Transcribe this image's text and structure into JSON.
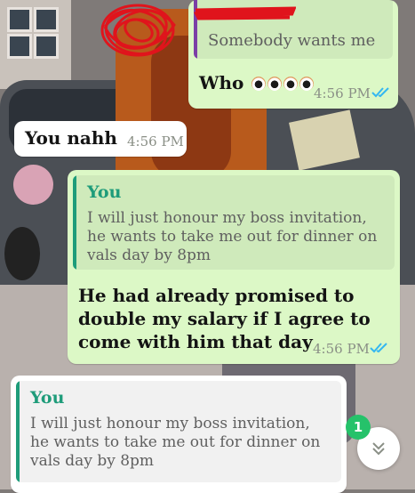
{
  "chat": {
    "m1": {
      "quote_text": "Somebody wants me",
      "text": "Who",
      "emojis": [
        "eyes-emoji",
        "eyes-emoji",
        "eyes-emoji",
        "eyes-emoji"
      ],
      "time": "4:56 PM"
    },
    "m2": {
      "text": "You nahh",
      "time": "4:56 PM"
    },
    "m3": {
      "quote_author": "You",
      "quote_text": "I will just honour my boss invitation, he wants to take me out for dinner on vals day by 8pm",
      "text": "He had already promised to double my salary if I agree to come with him that day",
      "time": "4:56 PM"
    },
    "m4": {
      "quote_author": "You",
      "quote_text": "I will just honour my boss invitation, he wants to take me out for dinner on vals day by 8pm"
    }
  },
  "unread_count": "1",
  "colors": {
    "outgoing_bubble": "#dcf8c6",
    "incoming_bubble": "#ffffff",
    "quote_bar_self": "#1e9c7a",
    "quote_bar_other": "#7b3fa6",
    "read_ticks": "#34b7f1",
    "badge": "#25c26a"
  },
  "icons": {
    "ticks": "double-check-icon",
    "scroll": "chevron-double-down-icon"
  }
}
